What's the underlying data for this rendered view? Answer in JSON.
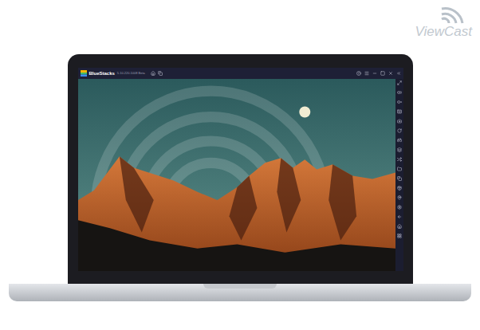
{
  "logo": {
    "text": "ViewCast"
  },
  "window": {
    "title": "BlueStacks",
    "version": "5.10.220.1008 Beta"
  }
}
